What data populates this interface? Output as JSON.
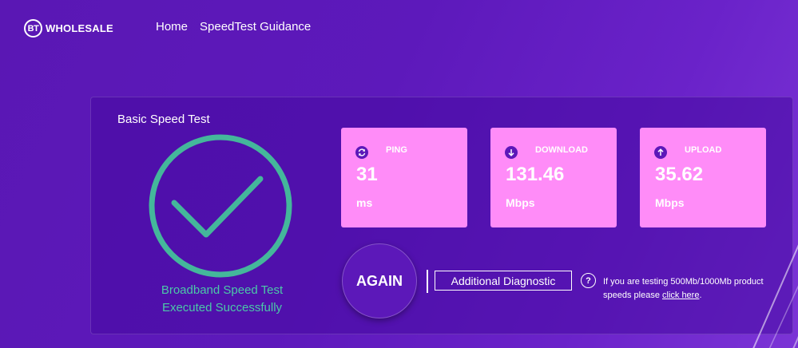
{
  "header": {
    "logo_mark": "BT",
    "logo_text": "WHOLESALE",
    "nav": [
      "Home",
      "SpeedTest Guidance"
    ]
  },
  "panel": {
    "title": "Basic Speed Test",
    "success_line1": "Broadband Speed Test",
    "success_line2": "Executed Successfully",
    "success_color": "#4bc8a8"
  },
  "cards": [
    {
      "label": "PING",
      "value": "31",
      "unit": "ms",
      "icon": "ping-refresh-icon"
    },
    {
      "label": "DOWNLOAD",
      "value": "131.46",
      "unit": "Mbps",
      "icon": "download-arrow-icon"
    },
    {
      "label": "UPLOAD",
      "value": "35.62",
      "unit": "Mbps",
      "icon": "upload-arrow-icon"
    }
  ],
  "actions": {
    "again_label": "AGAIN",
    "diagnostic_label": "Additional Diagnostic",
    "help_icon": "?",
    "help_text_prefix": "If you are testing 500Mb/1000Mb product speeds please ",
    "help_link": "click here",
    "help_text_suffix": "."
  },
  "colors": {
    "background": "#5d19bb",
    "card": "#ff8cf8",
    "icon_fill": "#5c18b9"
  }
}
